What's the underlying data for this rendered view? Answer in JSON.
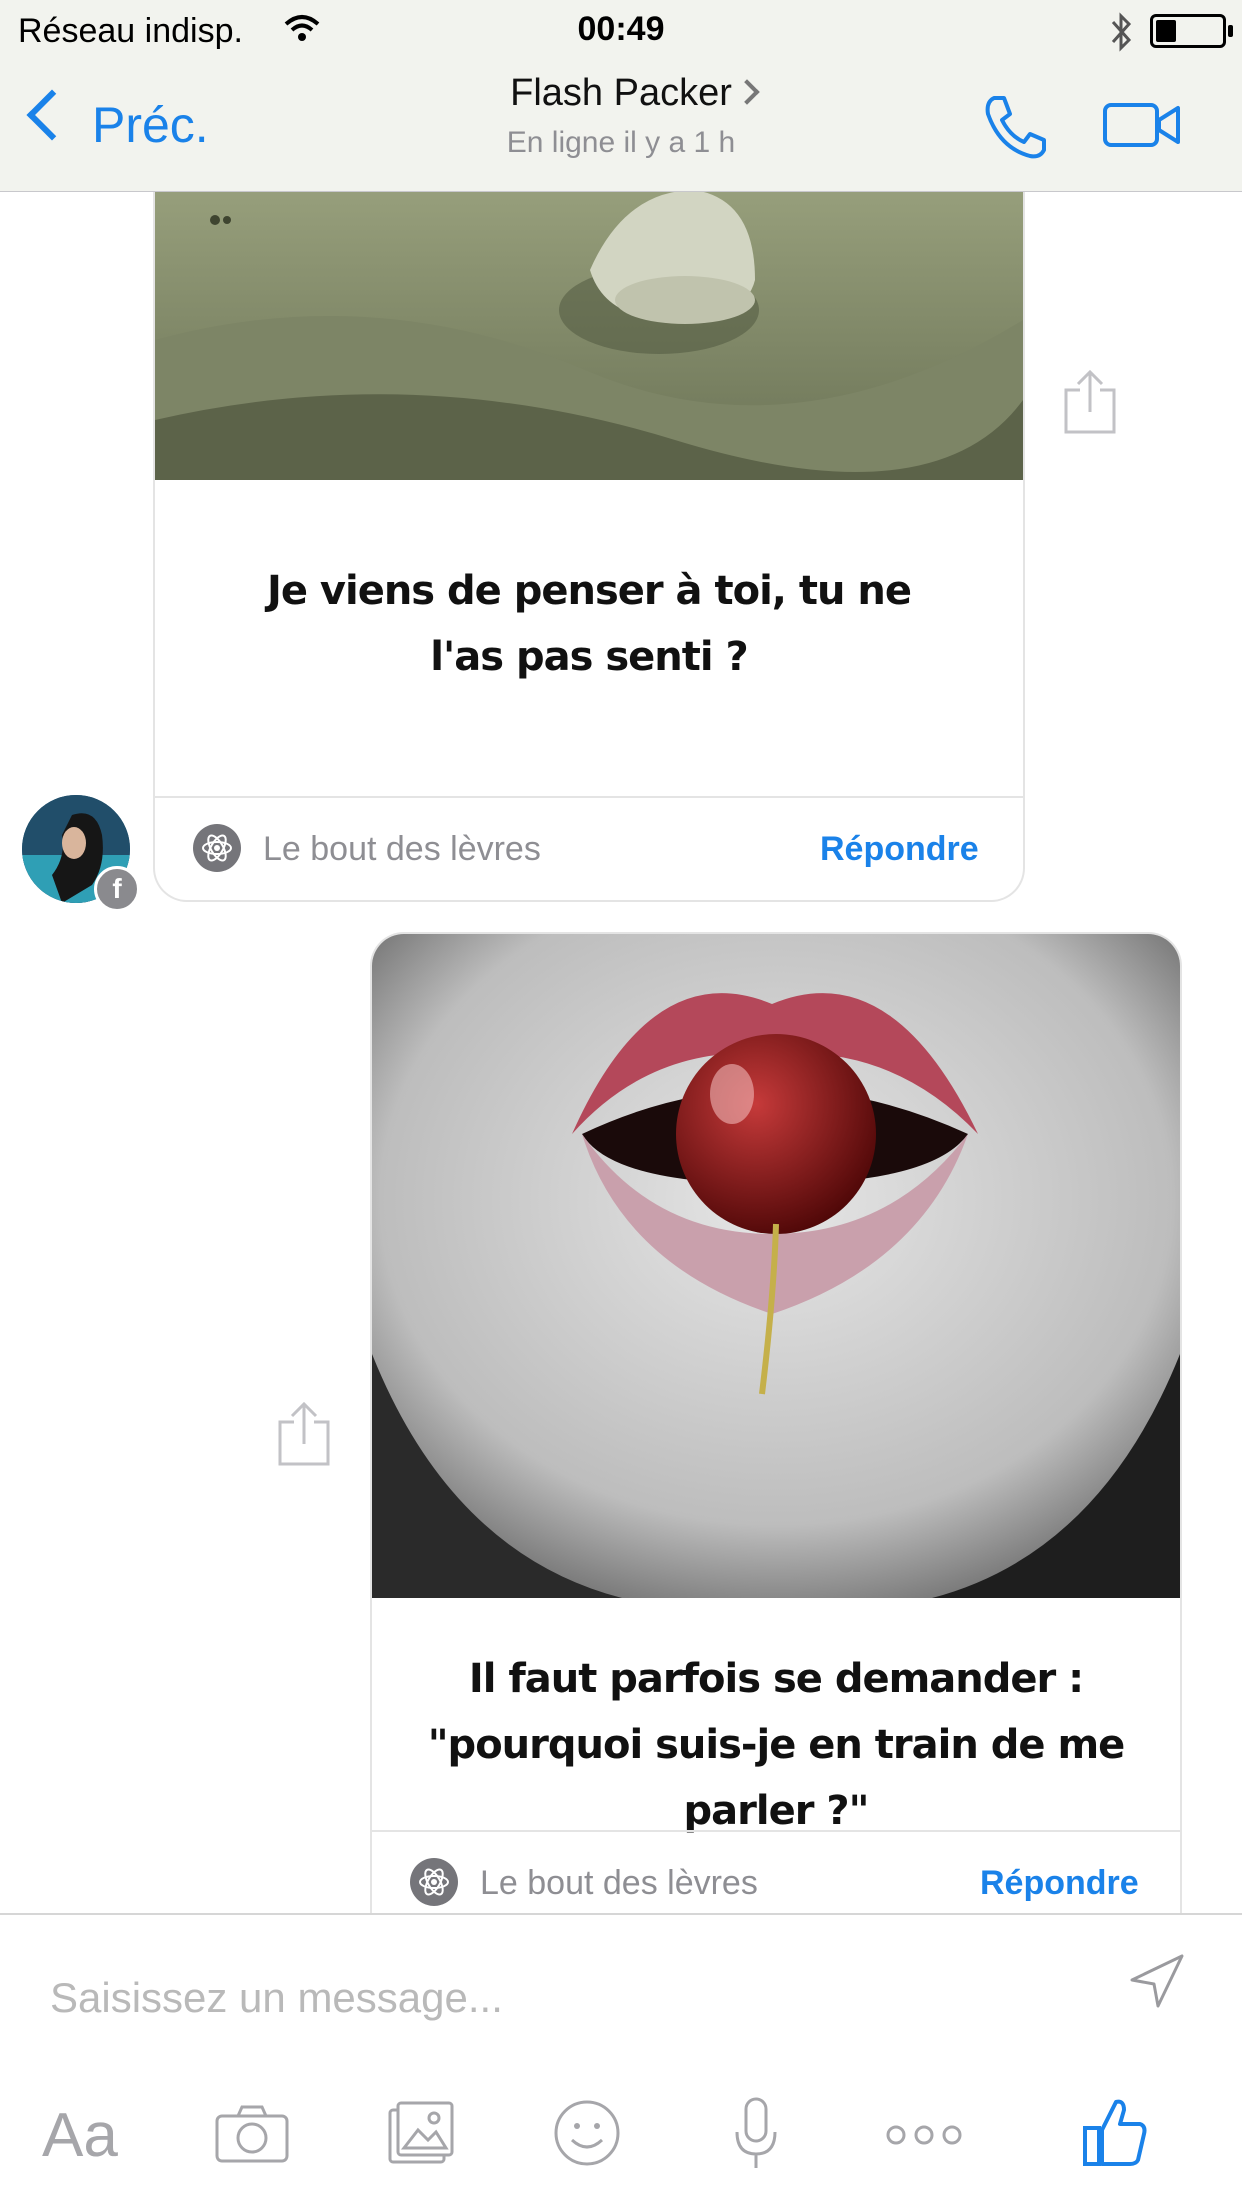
{
  "status_bar": {
    "carrier": "Réseau indisp.",
    "time": "00:49"
  },
  "header": {
    "back_label": "Préc.",
    "contact_name": "Flash Packer",
    "contact_status": "En ligne il y a 1 h"
  },
  "messages": [
    {
      "text": "Je viens de penser à toi, tu ne l'as pas senti ?",
      "source": "Le bout des lèvres",
      "reply": "Répondre"
    },
    {
      "text": "Il faut parfois se demander : \"pourquoi suis-je en train de me parler ?\"",
      "source": "Le bout des lèvres",
      "reply": "Répondre"
    }
  ],
  "composer": {
    "placeholder": "Saisissez un message...",
    "font_label": "Aa"
  },
  "colors": {
    "accent": "#1a82e9",
    "header_bg": "#f2f3ee",
    "muted": "#8e8e93"
  },
  "icons": [
    "wifi-icon",
    "bluetooth-icon",
    "battery-icon",
    "back-chevron-icon",
    "phone-icon",
    "video-icon",
    "share-icon",
    "atom-icon",
    "facebook-badge-icon",
    "camera-icon",
    "photo-gallery-icon",
    "emoji-icon",
    "microphone-icon",
    "more-icon",
    "like-icon",
    "send-icon"
  ]
}
